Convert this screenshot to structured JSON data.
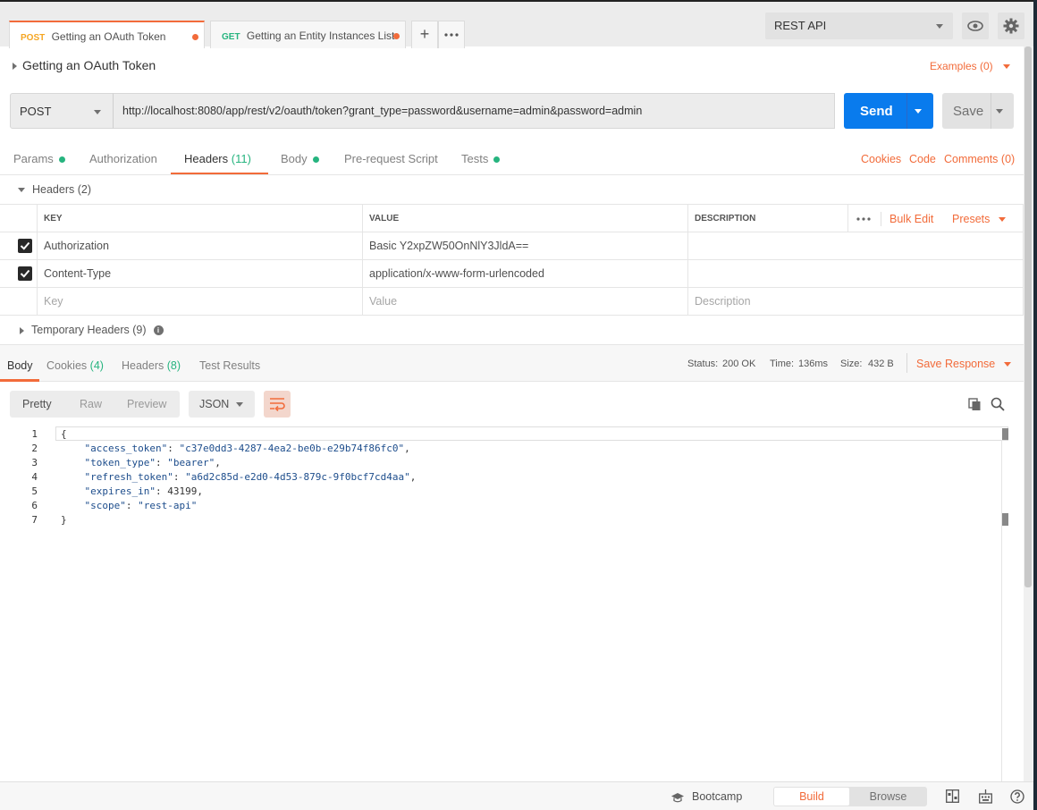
{
  "tabs": [
    {
      "method": "POST",
      "title": "Getting an OAuth Token",
      "method_color": "#f5a623"
    },
    {
      "method": "GET",
      "title": "Getting an Entity Instances List",
      "method_color": "#26b47f"
    }
  ],
  "environment": {
    "selected": "REST API"
  },
  "request": {
    "title": "Getting an OAuth Token",
    "examples_label": "Examples (0)",
    "method": "POST",
    "url": "http://localhost:8080/app/rest/v2/oauth/token?grant_type=password&username=admin&password=admin",
    "send_label": "Send",
    "save_label": "Save"
  },
  "request_tabs": {
    "params": "Params",
    "authorization": "Authorization",
    "headers": "Headers",
    "headers_count": "(11)",
    "body": "Body",
    "prerequest": "Pre-request Script",
    "tests": "Tests",
    "cookies": "Cookies",
    "code": "Code",
    "comments": "Comments (0)"
  },
  "headers_section": {
    "toggle_label": "Headers (2)",
    "columns": {
      "key": "KEY",
      "value": "VALUE",
      "description": "DESCRIPTION"
    },
    "bulk_edit": "Bulk Edit",
    "presets": "Presets",
    "rows": [
      {
        "key": "Authorization",
        "value": "Basic Y2xpZW50OnNlY3JldA==",
        "description": ""
      },
      {
        "key": "Content-Type",
        "value": "application/x-www-form-urlencoded",
        "description": ""
      }
    ],
    "placeholders": {
      "key": "Key",
      "value": "Value",
      "description": "Description"
    },
    "temporary_label": "Temporary Headers (9)"
  },
  "response": {
    "tabs": {
      "body": "Body",
      "cookies": "Cookies",
      "cookies_count": "(4)",
      "headers": "Headers",
      "headers_count": "(8)",
      "test_results": "Test Results"
    },
    "status_label": "Status:",
    "status_value": "200 OK",
    "time_label": "Time:",
    "time_value": "136ms",
    "size_label": "Size:",
    "size_value": "432 B",
    "save_response": "Save Response",
    "format": {
      "pretty": "Pretty",
      "raw": "Raw",
      "preview": "Preview",
      "type": "JSON"
    },
    "lines": [
      {
        "n": "1",
        "text": "{"
      },
      {
        "n": "2",
        "key": "\"access_token\"",
        "val": "\"c37e0dd3-4287-4ea2-be0b-e29b74f86fc0\"",
        "tail": ","
      },
      {
        "n": "3",
        "key": "\"token_type\"",
        "val": "\"bearer\"",
        "tail": ","
      },
      {
        "n": "4",
        "key": "\"refresh_token\"",
        "val": "\"a6d2c85d-e2d0-4d53-879c-9f0bcf7cd4aa\"",
        "tail": ","
      },
      {
        "n": "5",
        "key": "\"expires_in\"",
        "val": "43199",
        "tail": ","
      },
      {
        "n": "6",
        "key": "\"scope\"",
        "val": "\"rest-api\"",
        "tail": ""
      },
      {
        "n": "7",
        "text": "}"
      }
    ]
  },
  "statusbar": {
    "bootcamp": "Bootcamp",
    "build": "Build",
    "browse": "Browse"
  }
}
